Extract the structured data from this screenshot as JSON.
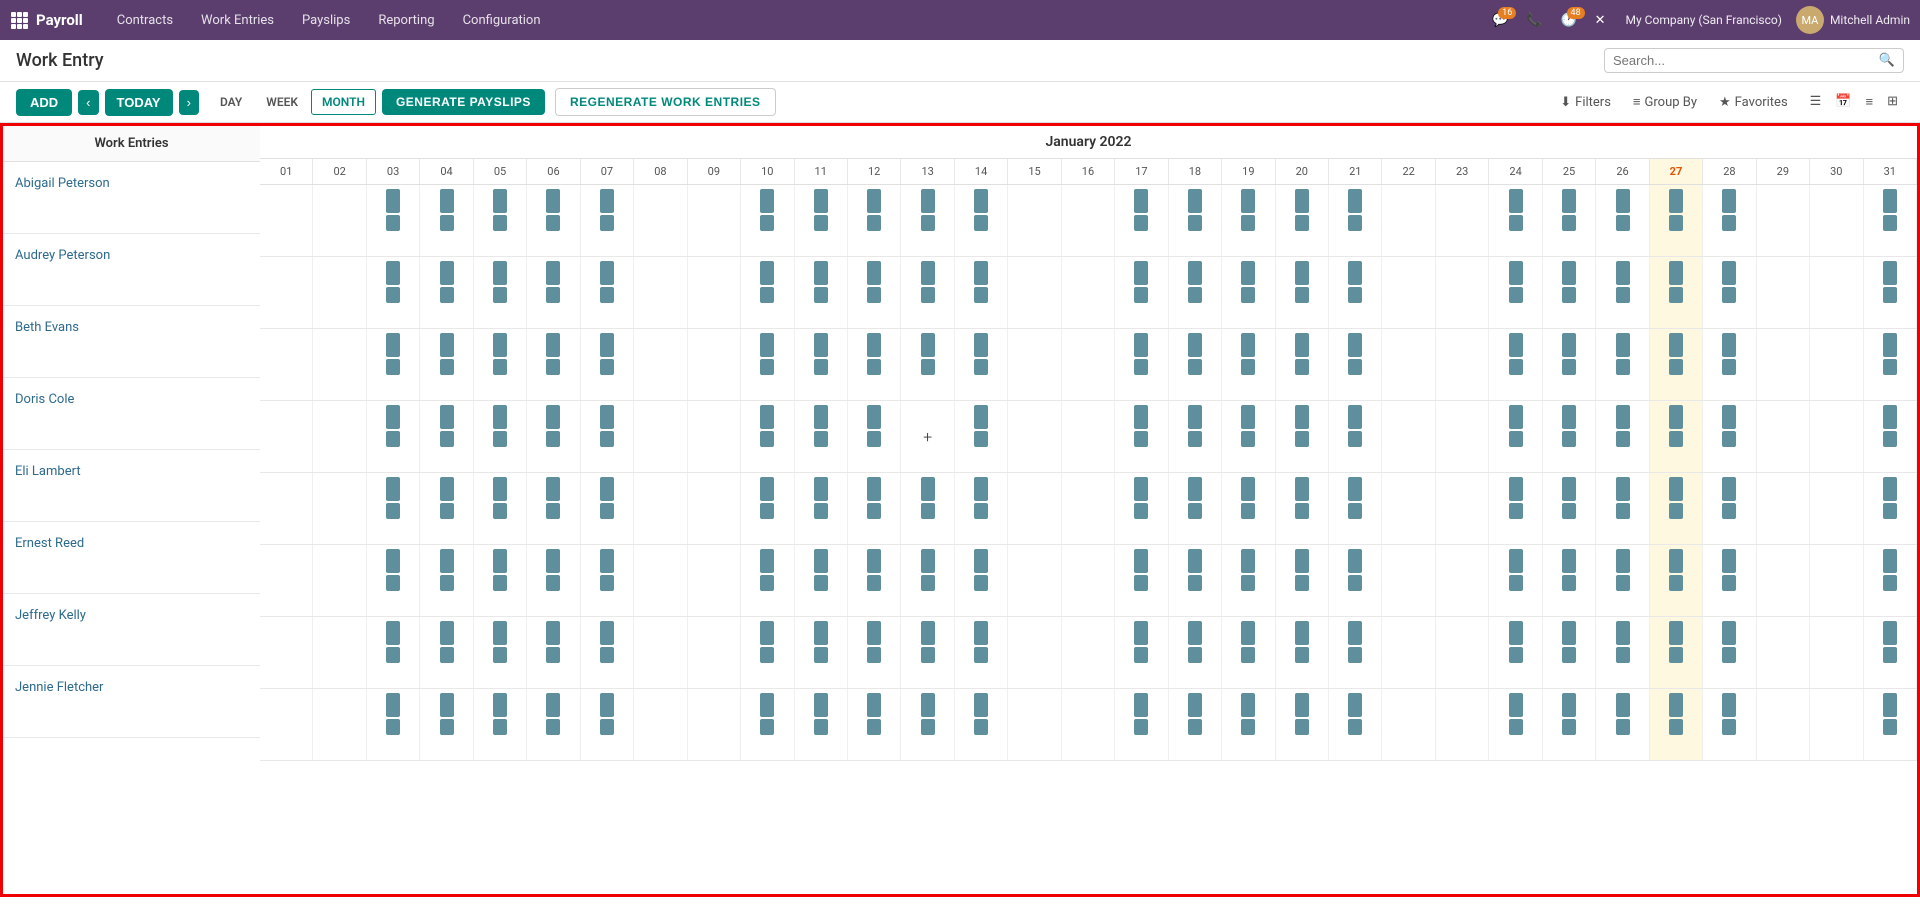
{
  "app": {
    "name": "Payroll"
  },
  "topnav": {
    "menu_items": [
      "Contracts",
      "Work Entries",
      "Payslips",
      "Reporting",
      "Configuration"
    ],
    "badge_messages": "16",
    "badge_clock": "48",
    "company": "My Company (San Francisco)",
    "user": "Mitchell Admin"
  },
  "header": {
    "title": "Work Entry",
    "search_placeholder": "Search..."
  },
  "toolbar": {
    "add_label": "ADD",
    "prev_label": "‹",
    "today_label": "TODAY",
    "next_label": "›",
    "day_label": "DAY",
    "week_label": "WEEK",
    "month_label": "MONTH",
    "generate_label": "GENERATE PAYSLIPS",
    "regenerate_label": "REGENERATE WORK ENTRIES",
    "filters_label": "Filters",
    "groupby_label": "Group By",
    "favorites_label": "Favorites"
  },
  "calendar": {
    "month_year": "January 2022",
    "today_col": 27,
    "days": [
      1,
      2,
      3,
      4,
      5,
      6,
      7,
      8,
      9,
      10,
      11,
      12,
      13,
      14,
      15,
      16,
      17,
      18,
      19,
      20,
      21,
      22,
      23,
      24,
      25,
      26,
      27,
      28,
      29,
      30,
      31
    ]
  },
  "employees": [
    {
      "name": "Abigail Peterson"
    },
    {
      "name": "Audrey Peterson"
    },
    {
      "name": "Beth Evans"
    },
    {
      "name": "Doris Cole"
    },
    {
      "name": "Eli Lambert"
    },
    {
      "name": "Ernest Reed"
    },
    {
      "name": "Jeffrey Kelly"
    },
    {
      "name": "Jennie Fletcher"
    }
  ],
  "sidebar": {
    "header": "Work Entries"
  }
}
